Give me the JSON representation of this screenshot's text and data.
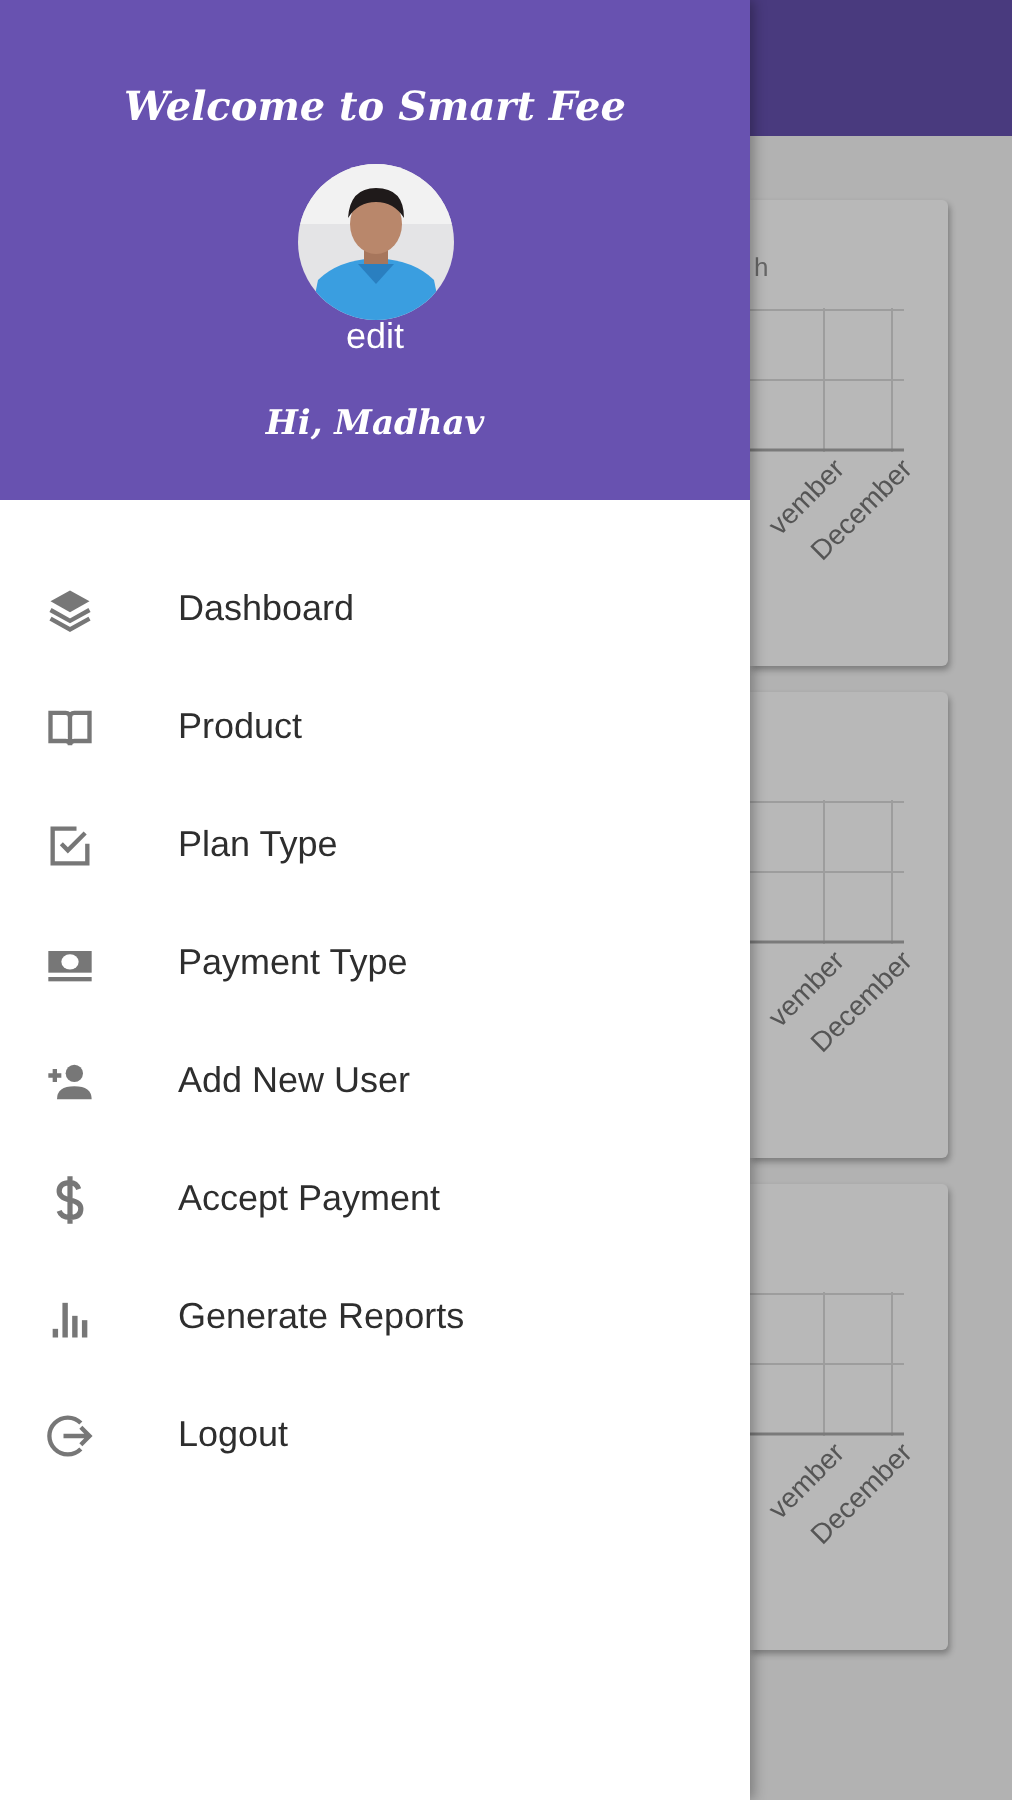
{
  "drawer": {
    "title": "Welcome to Smart Fee",
    "edit_label": "edit",
    "greeting": "Hi, Madhav",
    "items": [
      {
        "label": "Dashboard",
        "kind": "layers"
      },
      {
        "label": "Product",
        "kind": "book"
      },
      {
        "label": "Plan Type",
        "kind": "checkbox"
      },
      {
        "label": "Payment Type",
        "kind": "money"
      },
      {
        "label": "Add New User",
        "kind": "adduser"
      },
      {
        "label": "Accept Payment",
        "kind": "dollar"
      },
      {
        "label": "Generate Reports",
        "kind": "bars"
      },
      {
        "label": "Logout",
        "kind": "logout"
      }
    ]
  },
  "background": {
    "cards": [
      {
        "label": "h",
        "axis_labels": [
          "vember",
          "December"
        ]
      },
      {
        "axis_labels": [
          "vember",
          "December"
        ]
      },
      {
        "axis_labels": [
          "vember",
          "December"
        ]
      }
    ]
  }
}
